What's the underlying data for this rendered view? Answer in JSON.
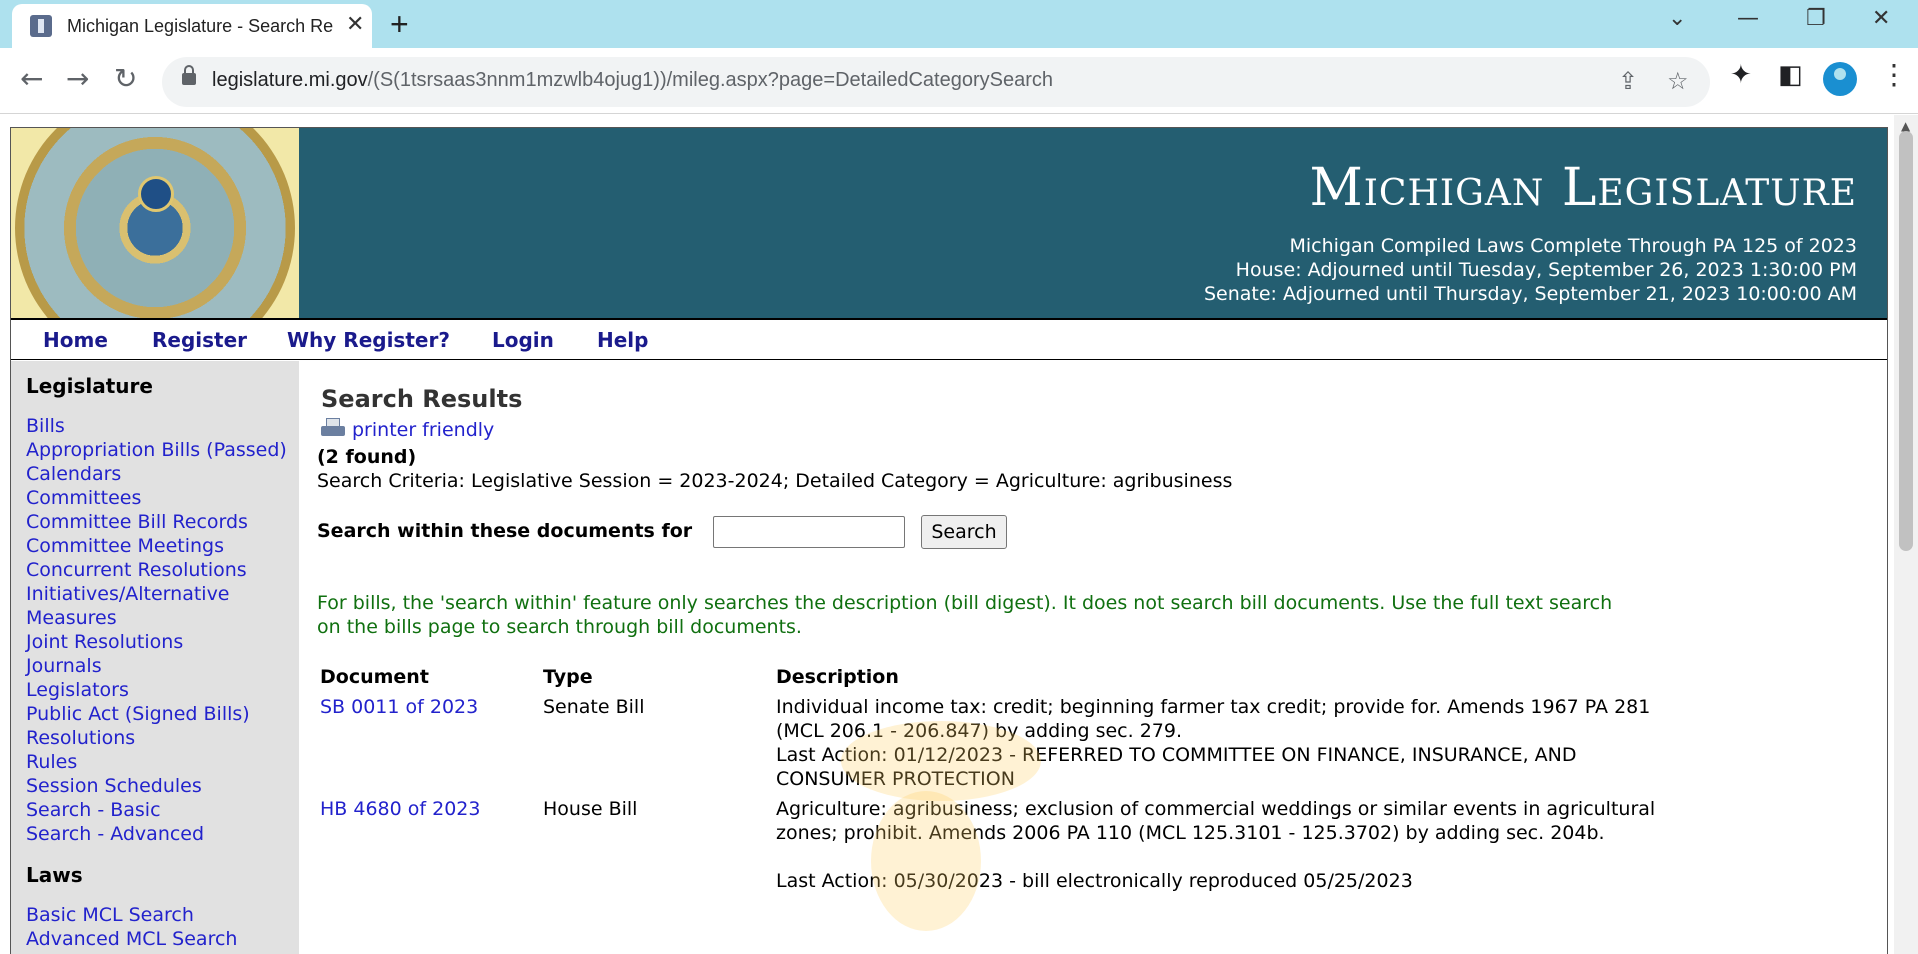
{
  "browser": {
    "tab_title": "Michigan Legislature - Search Re",
    "url_host": "legislature.mi.gov",
    "url_path": "/(S(1tsrsaas3nnm1mzwlb4ojug1))/mileg.aspx?page=DetailedCategorySearch"
  },
  "header": {
    "title": "Michigan Legislature",
    "compiled_laws": "Michigan Compiled Laws Complete Through PA 125 of 2023",
    "house_status": "House: Adjourned until Tuesday, September 26, 2023 1:30:00 PM",
    "senate_status": "Senate: Adjourned until Thursday, September 21, 2023 10:00:00 AM"
  },
  "nav": {
    "home": "Home",
    "register": "Register",
    "why_register": "Why Register?",
    "login": "Login",
    "help": "Help"
  },
  "sidebar": {
    "legislature_heading": "Legislature",
    "legislature_items": [
      "Bills",
      "Appropriation Bills (Passed)",
      "Calendars",
      "Committees",
      "Committee Bill Records",
      "Committee Meetings",
      "Concurrent Resolutions",
      "Initiatives/Alternative",
      "Measures",
      "Joint Resolutions",
      "Journals",
      "Legislators",
      "Public Act (Signed Bills)",
      "Resolutions",
      "Rules",
      "Session Schedules",
      "Search - Basic",
      "Search - Advanced"
    ],
    "laws_heading": "Laws",
    "laws_items": [
      "Basic MCL Search",
      "Advanced MCL Search"
    ]
  },
  "main": {
    "heading": "Search Results",
    "printer_friendly": "printer friendly",
    "found": "(2 found)",
    "criteria": "Search Criteria: Legislative Session = 2023-2024; Detailed Category = Agriculture: agribusiness",
    "search_within_label": "Search within these documents for",
    "search_within_value": "",
    "search_button": "Search",
    "note": "For bills, the 'search within' feature only searches the description (bill digest). It does not search bill documents. Use the full text search on the bills page to search through bill documents.",
    "table": {
      "headers": [
        "Document",
        "Type",
        "Description"
      ],
      "rows": [
        {
          "document": "SB 0011 of 2023",
          "type": "Senate Bill",
          "description": "Individual income tax: credit; beginning farmer tax credit; provide for. Amends 1967 PA 281 (MCL 206.1 - 206.847) by adding sec. 279.",
          "last_action": "Last Action: 01/12/2023 - REFERRED TO COMMITTEE ON FINANCE, INSURANCE, AND CONSUMER PROTECTION"
        },
        {
          "document": "HB 4680 of 2023",
          "type": "House Bill",
          "description": "Agriculture: agribusiness; exclusion of commercial weddings or similar events in agricultural zones; prohibit. Amends 2006 PA 110 (MCL 125.3101 - 125.3702) by adding sec. 204b.",
          "last_action": "Last Action: 05/30/2023 - bill electronically reproduced 05/25/2023"
        }
      ]
    }
  }
}
